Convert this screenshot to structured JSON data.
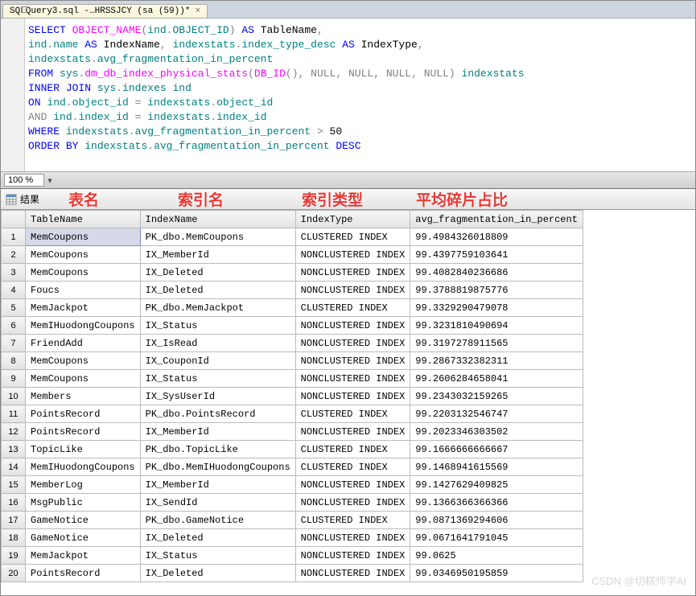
{
  "tab": {
    "label": "SQLQuery3.sql -…HRSSJCY (sa (59))*",
    "close": "×"
  },
  "sql": {
    "l1a": "SELECT",
    "l1b": "OBJECT_NAME",
    "l1c": "ind",
    "l1d": "OBJECT_ID",
    "l1e": "AS",
    "l1f": "TableName",
    "l2a": "ind",
    "l2b": "name",
    "l2c": "AS",
    "l2d": "IndexName",
    "l2e": "indexstats",
    "l2f": "index_type_desc",
    "l2g": "AS",
    "l2h": "IndexType",
    "l3a": "indexstats",
    "l3b": "avg_fragmentation_in_percent",
    "l4a": "FROM",
    "l4b": "sys",
    "l4c": "dm_db_index_physical_stats",
    "l4d": "DB_ID",
    "l4e": "NULL",
    "l4f": "NULL",
    "l4g": "NULL",
    "l4h": "NULL",
    "l4i": "indexstats",
    "l5a": "INNER",
    "l5b": "JOIN",
    "l5c": "sys",
    "l5d": "indexes",
    "l5e": "ind",
    "l6a": "ON",
    "l6b": "ind",
    "l6c": "object_id",
    "l6d": "indexstats",
    "l6e": "object_id",
    "l7a": "AND",
    "l7b": "ind",
    "l7c": "index_id",
    "l7d": "indexstats",
    "l7e": "index_id",
    "l8a": "WHERE",
    "l8b": "indexstats",
    "l8c": "avg_fragmentation_in_percent",
    "l8d": "50",
    "l9a": "ORDER",
    "l9b": "BY",
    "l9c": "indexstats",
    "l9d": "avg_fragmentation_in_percent",
    "l9e": "DESC"
  },
  "zoom": {
    "value": "100 %"
  },
  "results": {
    "tab_label": "结果"
  },
  "annotations": {
    "table_name": "表名",
    "index_name": "索引名",
    "index_type": "索引类型",
    "avg_frag": "平均碎片占比"
  },
  "grid": {
    "headers": [
      "TableName",
      "IndexName",
      "IndexType",
      "avg_fragmentation_in_percent"
    ],
    "rows": [
      [
        "MemCoupons",
        "PK_dbo.MemCoupons",
        "CLUSTERED INDEX",
        "99.4984326018809"
      ],
      [
        "MemCoupons",
        "IX_MemberId",
        "NONCLUSTERED INDEX",
        "99.4397759103641"
      ],
      [
        "MemCoupons",
        "IX_Deleted",
        "NONCLUSTERED INDEX",
        "99.4082840236686"
      ],
      [
        "Foucs",
        "IX_Deleted",
        "NONCLUSTERED INDEX",
        "99.3788819875776"
      ],
      [
        "MemJackpot",
        "PK_dbo.MemJackpot",
        "CLUSTERED INDEX",
        "99.3329290479078"
      ],
      [
        "MemIHuodongCoupons",
        "IX_Status",
        "NONCLUSTERED INDEX",
        "99.3231810490694"
      ],
      [
        "FriendAdd",
        "IX_IsRead",
        "NONCLUSTERED INDEX",
        "99.3197278911565"
      ],
      [
        "MemCoupons",
        "IX_CouponId",
        "NONCLUSTERED INDEX",
        "99.2867332382311"
      ],
      [
        "MemCoupons",
        "IX_Status",
        "NONCLUSTERED INDEX",
        "99.2606284658041"
      ],
      [
        "Members",
        "IX_SysUserId",
        "NONCLUSTERED INDEX",
        "99.2343032159265"
      ],
      [
        "PointsRecord",
        "PK_dbo.PointsRecord",
        "CLUSTERED INDEX",
        "99.2203132546747"
      ],
      [
        "PointsRecord",
        "IX_MemberId",
        "NONCLUSTERED INDEX",
        "99.2023346303502"
      ],
      [
        "TopicLike",
        "PK_dbo.TopicLike",
        "CLUSTERED INDEX",
        "99.1666666666667"
      ],
      [
        "MemIHuodongCoupons",
        "PK_dbo.MemIHuodongCoupons",
        "CLUSTERED INDEX",
        "99.1468941615569"
      ],
      [
        "MemberLog",
        "IX_MemberId",
        "NONCLUSTERED INDEX",
        "99.1427629409825"
      ],
      [
        "MsgPublic",
        "IX_SendId",
        "NONCLUSTERED INDEX",
        "99.1366366366366"
      ],
      [
        "GameNotice",
        "PK_dbo.GameNotice",
        "CLUSTERED INDEX",
        "99.0871369294606"
      ],
      [
        "GameNotice",
        "IX_Deleted",
        "NONCLUSTERED INDEX",
        "99.0671641791045"
      ],
      [
        "MemJackpot",
        "IX_Status",
        "NONCLUSTERED INDEX",
        "99.0625"
      ],
      [
        "PointsRecord",
        "IX_Deleted",
        "NONCLUSTERED INDEX",
        "99.0346950195859"
      ]
    ]
  },
  "watermark": "CSDN @切糕师学AI"
}
